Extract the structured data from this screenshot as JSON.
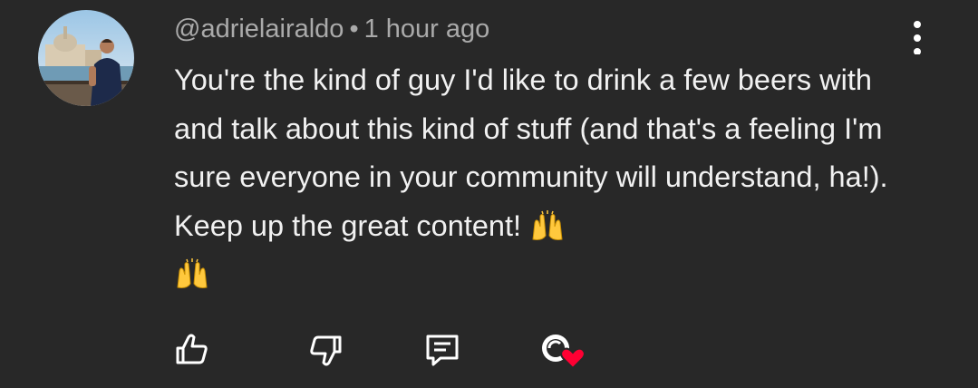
{
  "comment": {
    "author": "@adrielairaldo",
    "separator": "•",
    "timestamp": "1 hour ago",
    "text": "You're the kind of guy I'd like to drink a few beers with and talk about this kind of stuff (and that's a feeling I'm sure everyone in your community will understand, ha!). Keep up the great content!",
    "emojis": [
      "raising-hands-emoji",
      "raising-hands-emoji"
    ]
  },
  "actions": {
    "icons": [
      "thumbs-up-icon",
      "thumbs-down-icon",
      "reply-icon",
      "creator-heart-icon"
    ]
  },
  "menu": {
    "icon": "more-vert-icon"
  },
  "colors": {
    "background": "#282828",
    "text": "#f1f1f1",
    "meta_text": "#aaaaaa",
    "icon": "#ffffff",
    "heart": "#ff0033",
    "emoji": "#ffc83d"
  }
}
